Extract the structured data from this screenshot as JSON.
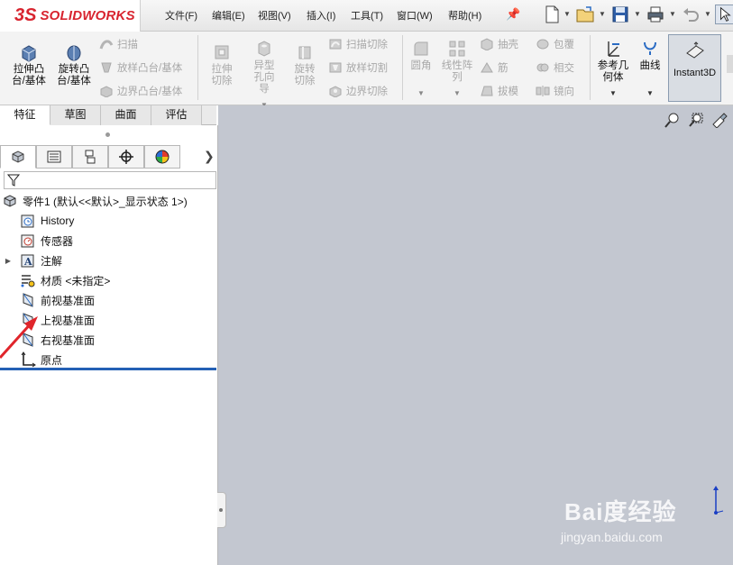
{
  "app": {
    "logo_ds": "3S",
    "logo_text": "SOLIDWORKS"
  },
  "menu": [
    {
      "label": "文件(F)"
    },
    {
      "label": "编辑(E)"
    },
    {
      "label": "视图(V)"
    },
    {
      "label": "插入(I)"
    },
    {
      "label": "工具(T)"
    },
    {
      "label": "窗口(W)"
    },
    {
      "label": "帮助(H)"
    }
  ],
  "command_manager": {
    "extrude_boss": "拉伸凸台/基体",
    "revolve_boss": "旋转凸台/基体",
    "sweep": "扫描",
    "loft": "放样凸台/基体",
    "boundary": "边界凸台/基体",
    "extrude_cut": "拉伸切除",
    "hole_wizard": "异型孔向导",
    "revolve_cut": "旋转切除",
    "swept_cut": "扫描切除",
    "lofted_cut": "放样切割",
    "boundary_cut": "边界切除",
    "fillet": "圆角",
    "linear_pattern": "线性阵列",
    "shell": "抽壳",
    "rib": "筋",
    "draft": "拔模",
    "wrap": "包覆",
    "intersect": "相交",
    "mirror": "镜向",
    "ref_geometry": "参考几何体",
    "curves": "曲线",
    "instant3d": "Instant3D"
  },
  "tabs": [
    {
      "label": "特征"
    },
    {
      "label": "草图"
    },
    {
      "label": "曲面"
    },
    {
      "label": "评估"
    }
  ],
  "tree": {
    "root": "零件1  (默认<<默认>_显示状态 1>)",
    "items": [
      {
        "label": "History"
      },
      {
        "label": "传感器"
      },
      {
        "label": "注解"
      },
      {
        "label": "材质 <未指定>"
      },
      {
        "label": "前视基准面"
      },
      {
        "label": "上视基准面"
      },
      {
        "label": "右视基准面"
      },
      {
        "label": "原点"
      }
    ]
  },
  "watermark": {
    "brand": "Bai度经验",
    "url": "jingyan.baidu.com"
  },
  "colors": {
    "brand_red": "#d8242f",
    "viewport": "#c3c7d0",
    "rollback_bar": "#2460b5",
    "arrow": "#e0252b"
  }
}
